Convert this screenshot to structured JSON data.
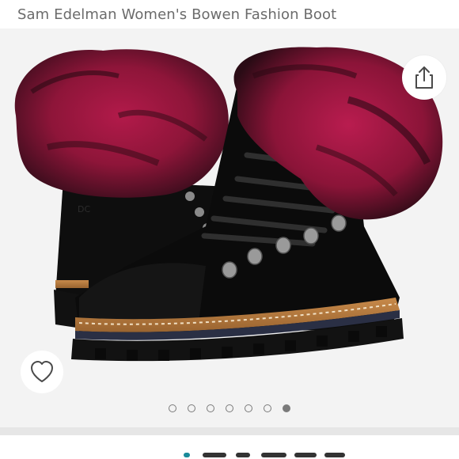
{
  "product": {
    "title": "Sam Edelman Women's Bowen Fashion Boot"
  },
  "gallery": {
    "image_count": 7,
    "active_index": 6
  },
  "icons": {
    "share": "share-icon",
    "favorite": "heart-icon"
  },
  "colors": {
    "background": "#f3f3f3",
    "dot": "#7a7a7a"
  }
}
